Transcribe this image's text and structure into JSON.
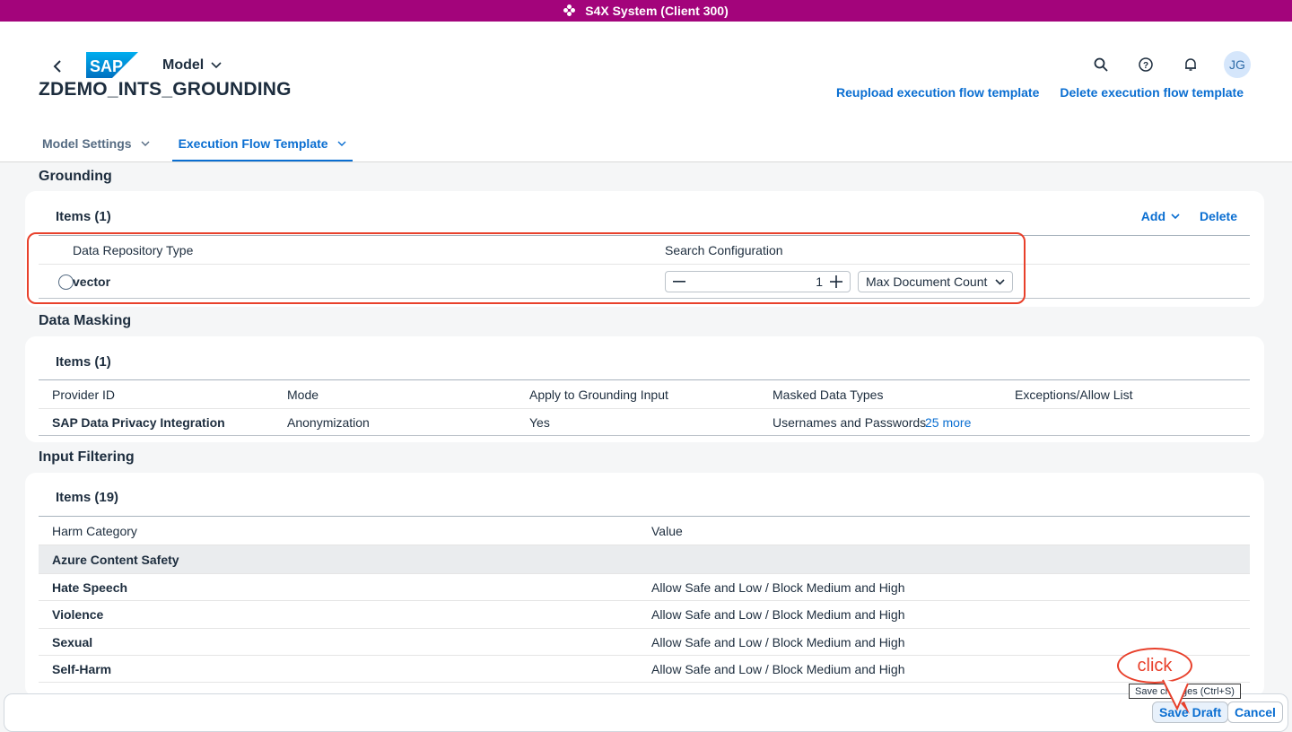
{
  "system_bar": {
    "title": "S4X System (Client 300)"
  },
  "shell": {
    "app_title": "Model",
    "avatar_initials": "JG",
    "icons": [
      "back-icon",
      "search-icon",
      "help-icon",
      "bell-icon"
    ],
    "logo_text": "SAP"
  },
  "object": {
    "title": "ZDEMO_INTS_GROUNDING",
    "actions": [
      "Reupload execution flow template",
      "Delete execution flow template"
    ]
  },
  "tabs": [
    {
      "label": "Model Settings",
      "active": false
    },
    {
      "label": "Execution Flow Template",
      "active": true
    }
  ],
  "grounding": {
    "section_title": "Grounding",
    "items_title": "Items (1)",
    "add_label": "Add",
    "delete_label": "Delete",
    "columns": [
      "Data Repository Type",
      "Search Configuration"
    ],
    "row": {
      "type": "vector",
      "count": "1",
      "count_type": "Max Document Count"
    }
  },
  "data_masking": {
    "section_title": "Data Masking",
    "items_title": "Items (1)",
    "columns": [
      "Provider ID",
      "Mode",
      "Apply to Grounding Input",
      "Masked Data Types",
      "Exceptions/Allow List"
    ],
    "row": {
      "provider": "SAP Data Privacy Integration",
      "mode": "Anonymization",
      "apply": "Yes",
      "masked": "Usernames and Passwords",
      "more": "25 more"
    }
  },
  "input_filtering": {
    "section_title": "Input Filtering",
    "items_title": "Items (19)",
    "columns": [
      "Harm Category",
      "Value"
    ],
    "group": "Azure Content Safety",
    "rows": [
      {
        "category": "Hate Speech",
        "value": "Allow Safe and Low / Block Medium and High"
      },
      {
        "category": "Violence",
        "value": "Allow Safe and Low / Block Medium and High"
      },
      {
        "category": "Sexual",
        "value": "Allow Safe and Low / Block Medium and High"
      },
      {
        "category": "Self-Harm",
        "value": "Allow Safe and Low / Block Medium and High"
      }
    ]
  },
  "footer": {
    "save_label": "Save Draft",
    "cancel_label": "Cancel",
    "tooltip": "Save changes (Ctrl+S)",
    "callout": "click"
  },
  "colors": {
    "system_bar": "#a3047b",
    "accent": "#0a6ed1",
    "highlight": "#e8402b"
  }
}
